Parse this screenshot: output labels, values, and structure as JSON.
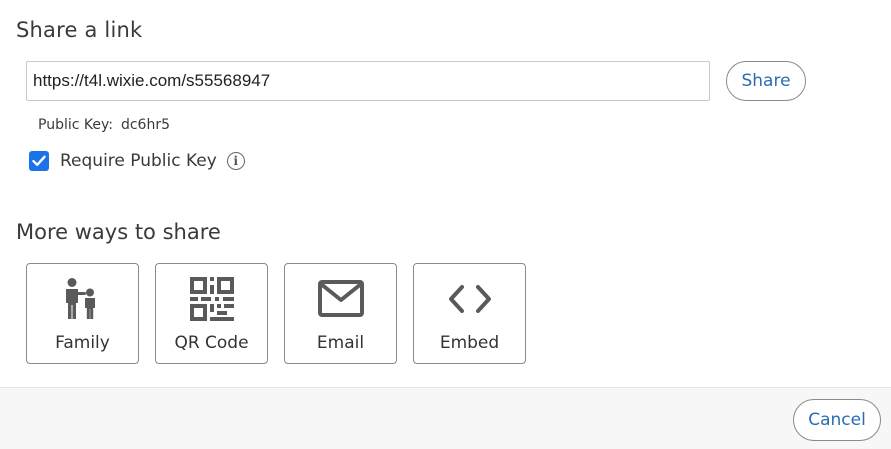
{
  "share_link": {
    "heading": "Share a link",
    "url": "https://t4l.wixie.com/s55568947",
    "share_button": "Share",
    "public_key_label": "Public Key:",
    "public_key_value": "dc6hr5",
    "require_label": "Require Public Key",
    "require_checked": true,
    "info_glyph": "i"
  },
  "more_ways": {
    "heading": "More ways to share",
    "options": [
      {
        "label": "Family",
        "icon": "family-icon"
      },
      {
        "label": "QR Code",
        "icon": "qr-code-icon"
      },
      {
        "label": "Email",
        "icon": "email-icon"
      },
      {
        "label": "Embed",
        "icon": "embed-icon"
      }
    ]
  },
  "footer": {
    "cancel_button": "Cancel"
  },
  "colors": {
    "accent": "#2b6cb0",
    "checkbox": "#1a73e8",
    "icon": "#5a5a5a"
  }
}
